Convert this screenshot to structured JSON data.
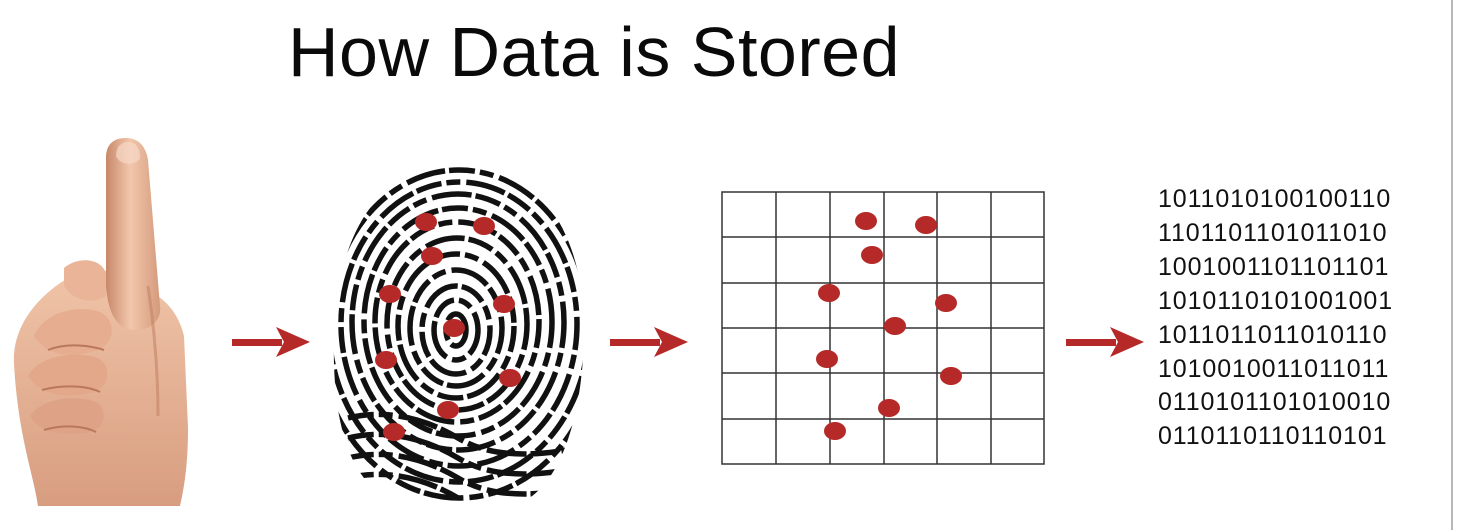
{
  "slide": {
    "title": "How Data is Stored"
  },
  "binary_lines": [
    "1011010100100110",
    "1101101101011010",
    "1001001101101101",
    "1010110101001001",
    "1011011011010110",
    "1010010011011011",
    "0110101101010010",
    "0110110110110101"
  ],
  "icons": {
    "hand": "raised-index-finger-hand",
    "fingerprint": "fingerprint-with-minutiae-dots",
    "grid": "minutiae-grid",
    "arrow": "right-arrow"
  },
  "colors": {
    "accent_red": "#b52a28",
    "ink": "#111111",
    "grid_line": "#333333"
  }
}
